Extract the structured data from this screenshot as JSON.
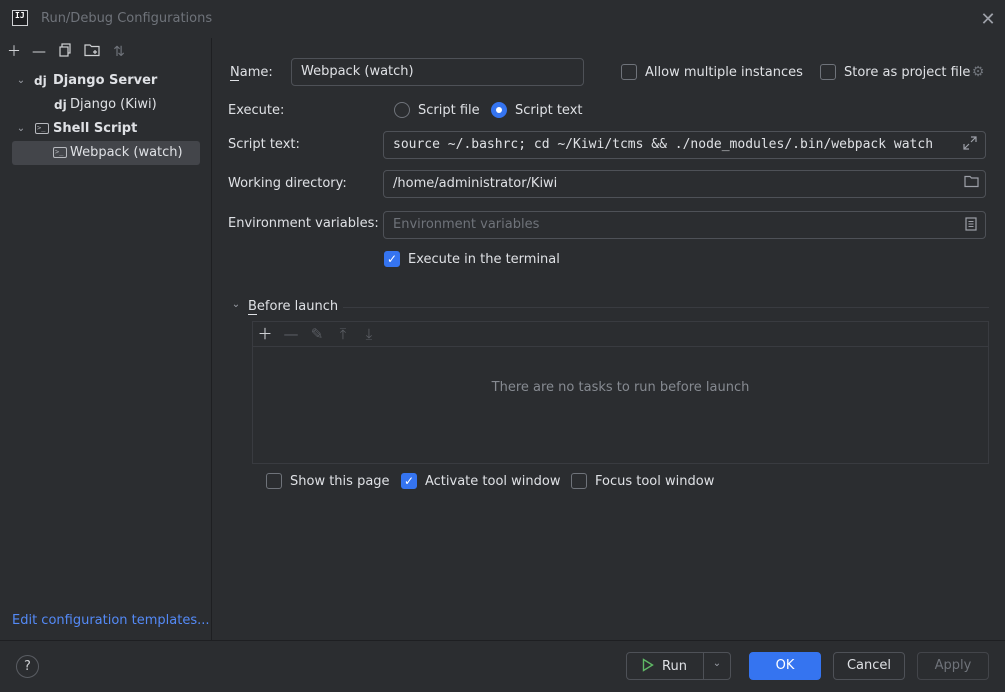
{
  "window": {
    "title": "Run/Debug Configurations",
    "app_icon_text": "IJ"
  },
  "colors": {
    "accent": "#3574f0",
    "link": "#548af7",
    "background": "#2b2d30"
  },
  "toolbar": {
    "icons": [
      "add-icon",
      "remove-icon",
      "copy-icon",
      "new-folder-icon",
      "sort-icon"
    ]
  },
  "tree": {
    "items": [
      {
        "label": "Django Server",
        "prefix": "dj",
        "bold": true,
        "expanded": true
      },
      {
        "label": "Django (Kiwi)",
        "prefix": "dj",
        "bold": false
      },
      {
        "label": "Shell Script",
        "prefix": "terminal-icon",
        "bold": true,
        "expanded": true
      },
      {
        "label": "Webpack (watch)",
        "prefix": "terminal-icon",
        "bold": false,
        "selected": true
      }
    ],
    "dj_prefix": "dj"
  },
  "edit_templates_link": "Edit configuration templates...",
  "form": {
    "name_label": "Name:",
    "name_value": "Webpack (watch)",
    "allow_multiple_label": "Allow multiple instances",
    "allow_multiple_checked": false,
    "store_project_label": "Store as project file",
    "store_project_checked": false,
    "execute_label": "Execute:",
    "script_file_label": "Script file",
    "script_text_radio_label": "Script text",
    "execute_selected": "Script text",
    "script_text_label": "Script text:",
    "script_text_value": "source ~/.bashrc; cd ~/Kiwi/tcms && ./node_modules/.bin/webpack watch",
    "working_dir_label": "Working directory:",
    "working_dir_value": "/home/administrator/Kiwi",
    "env_label": "Environment variables:",
    "env_placeholder": "Environment variables",
    "exec_terminal_label": "Execute in the terminal",
    "exec_terminal_checked": true
  },
  "before_launch": {
    "title": "Before launch",
    "empty_message": "There are no tasks to run before launch",
    "show_page_label": "Show this page",
    "show_page_checked": false,
    "activate_tool_label": "Activate tool window",
    "activate_tool_checked": true,
    "focus_tool_label": "Focus tool window",
    "focus_tool_checked": false
  },
  "footer": {
    "help": "?",
    "run_label": "Run",
    "ok_label": "OK",
    "cancel_label": "Cancel",
    "apply_label": "Apply"
  }
}
